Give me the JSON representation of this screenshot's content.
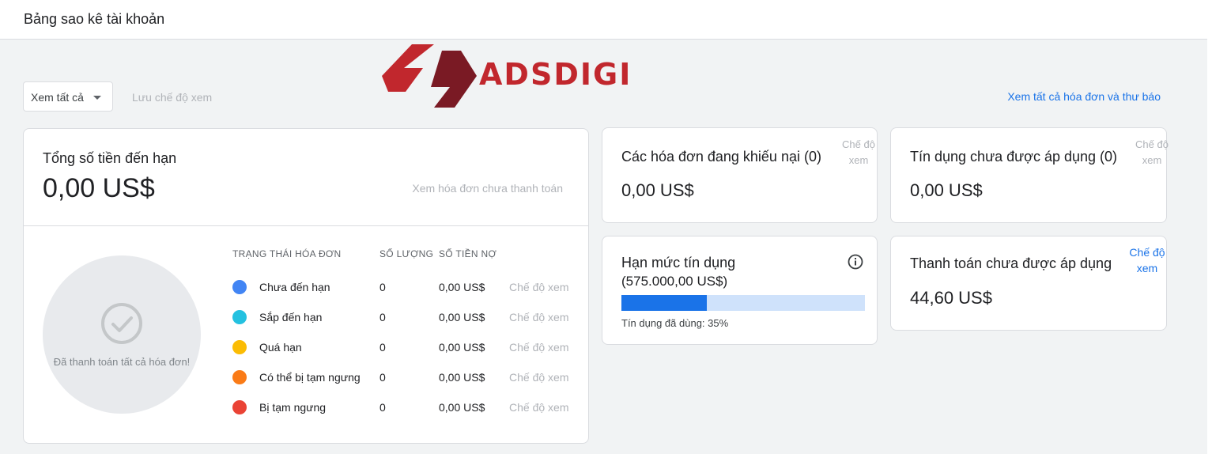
{
  "header": {
    "title": "Bảng sao kê tài khoản"
  },
  "toolbar": {
    "filter_label": "Xem tất cả",
    "save_view_label": "Lưu chế độ xem",
    "view_all_link": "Xem tất cả hóa đơn và thư báo"
  },
  "logo": {
    "text": "ADSDIGI"
  },
  "due": {
    "title": "Tổng số tiền đến hạn",
    "amount": "0,00 US$",
    "unpaid_link": "Xem hóa đơn chưa thanh toán",
    "paid_all_text": "Đã thanh toán tất cả hóa đơn!",
    "columns": {
      "status": "TRẠNG THÁI HÓA ĐƠN",
      "count": "SỐ LƯỢNG",
      "owed": "SỐ TIỀN NỢ"
    },
    "rows": [
      {
        "label": "Chưa đến hạn",
        "count": "0",
        "owed": "0,00 US$",
        "view": "Chế độ xem",
        "color": "#4285f4"
      },
      {
        "label": "Sắp đến hạn",
        "count": "0",
        "owed": "0,00 US$",
        "view": "Chế độ xem",
        "color": "#24c1e0"
      },
      {
        "label": "Quá hạn",
        "count": "0",
        "owed": "0,00 US$",
        "view": "Chế độ xem",
        "color": "#fbbc04"
      },
      {
        "label": "Có thể bị tạm ngưng",
        "count": "0",
        "owed": "0,00 US$",
        "view": "Chế độ xem",
        "color": "#fa7b17"
      },
      {
        "label": "Bị tạm ngưng",
        "count": "0",
        "owed": "0,00 US$",
        "view": "Chế độ xem",
        "color": "#ea4335"
      }
    ]
  },
  "disputed": {
    "title": "Các hóa đơn đang khiếu nại (0)",
    "amount": "0,00 US$",
    "view_line1": "Chế độ",
    "view_line2": "xem"
  },
  "unapplied_credit": {
    "title": "Tín dụng chưa được áp dụng (0)",
    "amount": "0,00 US$",
    "view_line1": "Chế độ",
    "view_line2": "xem"
  },
  "credit_limit": {
    "title": "Hạn mức tín dụng",
    "limit": "(575.000,00 US$)",
    "used_caption": "Tín dụng đã dùng: 35%",
    "used_fraction": 0.35
  },
  "unapplied_payment": {
    "title": "Thanh toán chưa được áp dụng",
    "amount": "44,60 US$",
    "view_line1": "Chế độ",
    "view_line2": "xem"
  },
  "colors": {
    "accent": "#1a73e8",
    "bar_track": "#cfe2fb",
    "muted": "#b0b3b8",
    "logo_red": "#c1272d",
    "logo_dark": "#7a1a24"
  }
}
